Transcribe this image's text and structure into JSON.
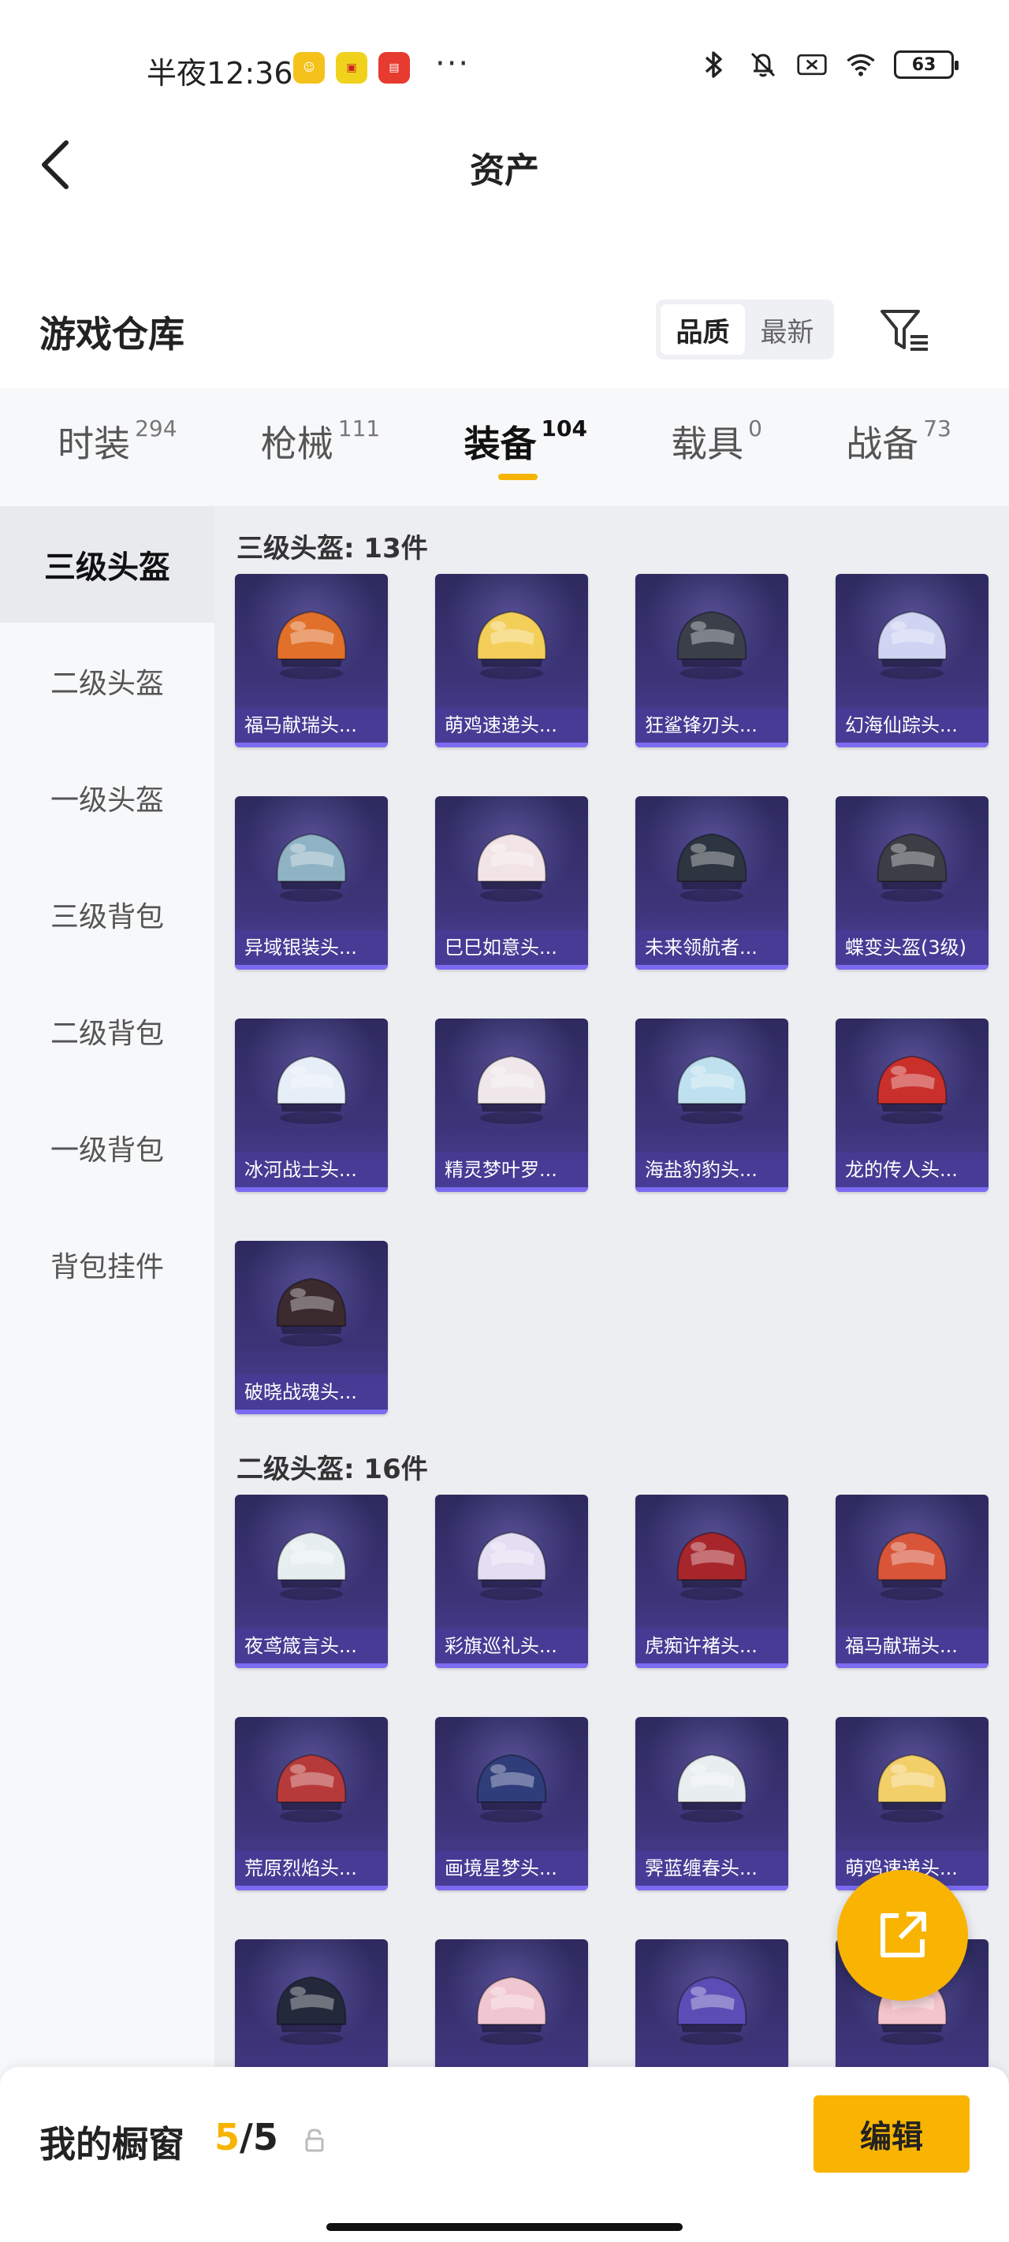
{
  "status_bar": {
    "time": "半夜12:36",
    "dots": "···",
    "battery": "63",
    "apps": [
      {
        "name": "app-icon-1",
        "color": "#f5c21b"
      },
      {
        "name": "app-icon-2",
        "color": "#f0d21c"
      },
      {
        "name": "app-icon-3",
        "color": "#e63b2e"
      }
    ]
  },
  "header": {
    "title": "资产"
  },
  "warehouse": {
    "title": "游戏仓库",
    "sort_options": [
      "品质",
      "最新"
    ],
    "active_sort": "品质"
  },
  "tabs": [
    {
      "label": "时装",
      "count": "294"
    },
    {
      "label": "枪械",
      "count": "111"
    },
    {
      "label": "装备",
      "count": "104",
      "active": true
    },
    {
      "label": "载具",
      "count": "0"
    },
    {
      "label": "战备",
      "count": "73"
    }
  ],
  "side_nav": [
    "三级头盔",
    "二级头盔",
    "一级头盔",
    "三级背包",
    "二级背包",
    "一级背包",
    "背包挂件"
  ],
  "sections": [
    {
      "title": "三级头盔: 13件",
      "items": [
        {
          "name": "福马献瑞头...",
          "color": "#e0702a"
        },
        {
          "name": "萌鸡速递头...",
          "color": "#f3cf5a"
        },
        {
          "name": "狂鲨锋刃头...",
          "color": "#3a3f4a"
        },
        {
          "name": "幻海仙踪头...",
          "color": "#cfd4f3"
        },
        {
          "name": "异域银装头...",
          "color": "#8fb3c4"
        },
        {
          "name": "巳巳如意头...",
          "color": "#f1e3e6"
        },
        {
          "name": "未来领航者...",
          "color": "#2d3540"
        },
        {
          "name": "蝶变头盔(3级)",
          "color": "#3b3f45"
        },
        {
          "name": "冰河战士头...",
          "color": "#e6eef8"
        },
        {
          "name": "精灵梦叶罗...",
          "color": "#efe7e9"
        },
        {
          "name": "海盐豹豹头...",
          "color": "#bfe0ef"
        },
        {
          "name": "龙的传人头...",
          "color": "#c9302c"
        },
        {
          "name": "破晓战魂头...",
          "color": "#3b2a2e"
        }
      ]
    },
    {
      "title": "二级头盔: 16件",
      "items": [
        {
          "name": "夜鸢箴言头...",
          "color": "#e7eef0"
        },
        {
          "name": "彩旗巡礼头...",
          "color": "#e3def2"
        },
        {
          "name": "虎痴许褚头...",
          "color": "#a6262b"
        },
        {
          "name": "福马献瑞头...",
          "color": "#d8553a"
        },
        {
          "name": "荒原烈焰头...",
          "color": "#b73a3a"
        },
        {
          "name": "画境星梦头...",
          "color": "#2f3d7a"
        },
        {
          "name": "霁蓝缠春头...",
          "color": "#e8eef0"
        },
        {
          "name": "萌鸡速递头...",
          "color": "#f3cf6a"
        },
        {
          "name": "",
          "color": "#23293a"
        },
        {
          "name": "",
          "color": "#f0c6d0"
        },
        {
          "name": "",
          "color": "#5a4db5"
        },
        {
          "name": "",
          "color": "#f4c4cb"
        }
      ]
    }
  ],
  "bottom_bar": {
    "title": "我的橱窗",
    "current": "5",
    "separator": "/",
    "total": "5",
    "edit_label": "编辑"
  },
  "colors": {
    "accent": "#f8b400",
    "card_bg": "#3a3478"
  }
}
